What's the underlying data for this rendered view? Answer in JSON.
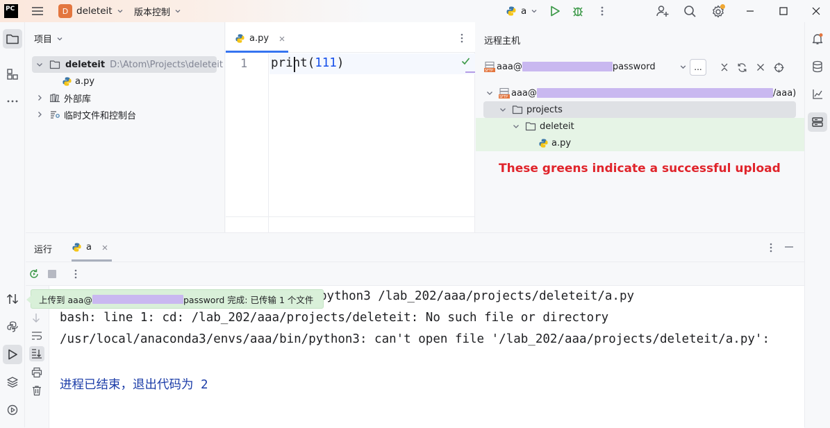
{
  "titlebar": {
    "logo": "PC",
    "project_badge": "D",
    "project_name": "deleteit",
    "vcs_label": "版本控制",
    "run_config": "a"
  },
  "project_panel": {
    "title": "项目",
    "root_name": "deleteit",
    "root_path": "D:\\Atom\\Projects\\deleteit",
    "file": "a.py",
    "external_libs": "外部库",
    "scratches": "临时文件和控制台"
  },
  "editor": {
    "tab_label": "a.py",
    "line_number": "1",
    "code_fn": "print",
    "code_open": "(",
    "code_arg": "111",
    "code_close": ")"
  },
  "remote": {
    "title": "远程主机",
    "host_prefix": "aaa@",
    "host_suffix": "password",
    "more_button": "...",
    "tree_root_prefix": "aaa@",
    "tree_root_suffix": "/aaa)",
    "folder1": "projects",
    "folder2": "deleteit",
    "file": "a.py",
    "annotation": "These greens indicate a successful upload",
    "annotation_color": "#e0242b",
    "success_highlight": "#e6f4e6"
  },
  "run_panel": {
    "title": "运行",
    "tab_label": "a",
    "toast_prefix": "上传到 aaa@",
    "toast_suffix": "password 完成: 已传输 1 个文件",
    "console": {
      "line1": "python3 /lab_202/aaa/projects/deleteit/a.py",
      "line2": "bash: line 1: cd: /lab_202/aaa/projects/deleteit: No such file or directory",
      "line3": "/usr/local/anaconda3/envs/aaa/bin/python3: can't open file '/lab_202/aaa/projects/deleteit/a.py':",
      "line4": "进程已结束，退出代码为 2"
    }
  }
}
